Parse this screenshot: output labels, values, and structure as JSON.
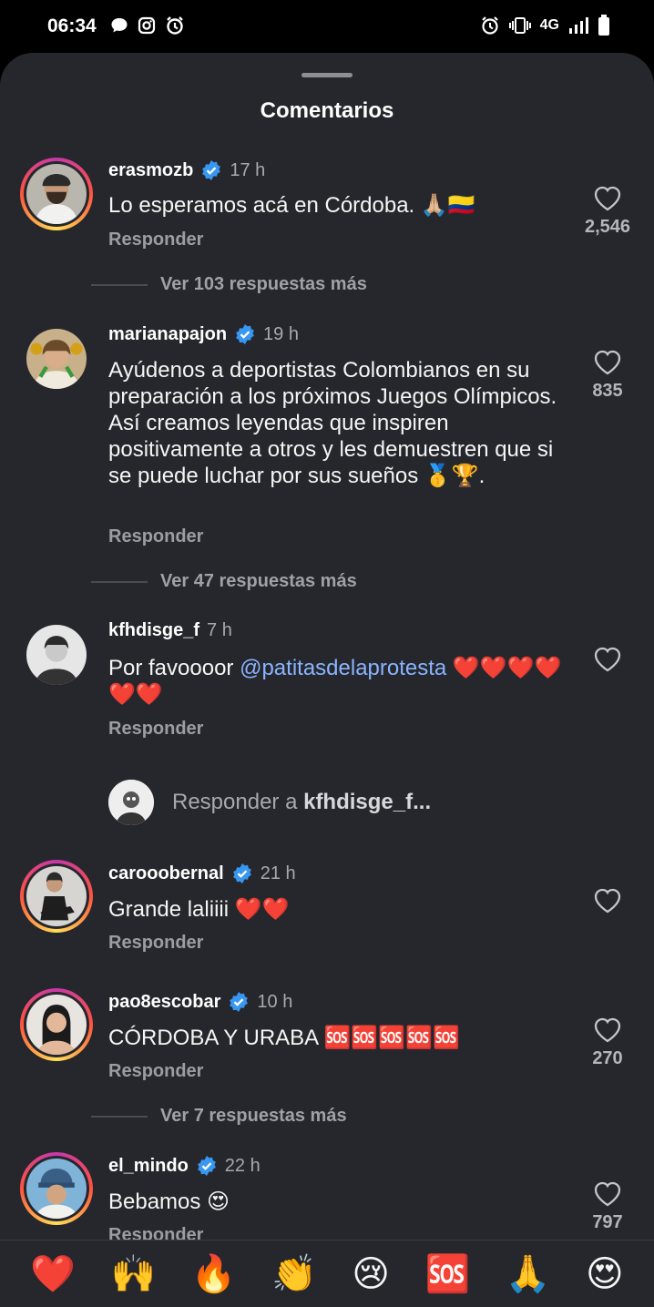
{
  "status": {
    "time": "06:34",
    "network": "4G"
  },
  "sheet": {
    "title": "Comentarios"
  },
  "comments": [
    {
      "username": "erasmozb",
      "verified": true,
      "time": "17 h",
      "text": "Lo esperamos acá en Córdoba. 🙏🏼🇨🇴",
      "reply_label": "Responder",
      "likes": "2,546",
      "view_more": "Ver 103 respuestas más"
    },
    {
      "username": "marianapajon",
      "verified": true,
      "time": "19 h",
      "text": "Ayúdenos a deportistas Colombianos en su preparación a los próximos Juegos Olímpicos. Así creamos leyendas que inspiren positivamente a otros y les demuestren que si se puede luchar por sus sueños 🥇🏆.",
      "reply_label": "Responder",
      "likes": "835",
      "view_more": "Ver 47 respuestas más"
    },
    {
      "username": "kfhdisge_f",
      "verified": false,
      "time": "7 h",
      "text_before": "Por favoooor ",
      "mention": "@patitasdelaprotesta",
      "text_after": " ❤️❤️❤️❤️❤️❤️",
      "reply_label": "Responder"
    },
    {
      "username": "carooobernal",
      "verified": true,
      "time": "21 h",
      "text": "Grande laliiii ❤️❤️",
      "reply_label": "Responder"
    },
    {
      "username": "pao8escobar",
      "verified": true,
      "time": "10 h",
      "text": "CÓRDOBA Y URABA 🆘🆘🆘🆘🆘",
      "reply_label": "Responder",
      "likes": "270",
      "view_more": "Ver 7 respuestas más"
    },
    {
      "username": "el_mindo",
      "verified": true,
      "time": "22 h",
      "text": "Bebamos 😍",
      "reply_label": "Responder",
      "likes": "797"
    }
  ],
  "reply_input": {
    "prefix": "Responder a ",
    "username": "kfhdisge_f..."
  },
  "emoji_bar": [
    "❤️",
    "🙌",
    "🔥",
    "👏",
    "😢",
    "🆘",
    "🙏",
    "😍"
  ],
  "colors": {
    "sheet_bg": "#25272c",
    "verified": "#3897f0",
    "mention": "#8ab4ff"
  }
}
